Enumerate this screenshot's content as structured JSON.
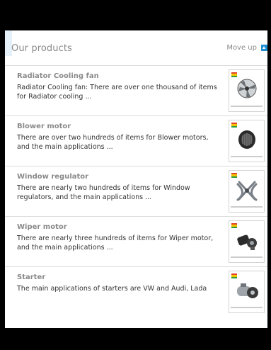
{
  "section": {
    "title": "Our products",
    "move_up_label": "Move up"
  },
  "products": [
    {
      "title": "Radiator Cooling fan",
      "description": "Radiator Cooling fan: There are over one thousand of items for Radiator cooling ...",
      "image": "radiator-cooling-fan-image"
    },
    {
      "title": "Blower motor",
      "description": "There are over two hundreds of items for Blower motors, and the main applications ...",
      "image": "blower-motor-image"
    },
    {
      "title": "Window regulator",
      "description": "There are nearly two hundreds of items for Window regulators, and the main applications ...",
      "image": "window-regulator-image"
    },
    {
      "title": "Wiper motor",
      "description": "There are nearly three hundreds of items for Wiper motor, and the main applications ...",
      "image": "wiper-motor-image"
    },
    {
      "title": "Starter",
      "description": "The main applications of starters are VW and Audi, Lada",
      "image": "starter-image"
    }
  ],
  "colors": {
    "frame": "#000000",
    "heading": "#8a8a8a",
    "text": "#333333",
    "accent": "#1f8fd6",
    "flag_top": "#e0452b",
    "flag_mid": "#f2c500",
    "flag_bottom": "#2d9b3a"
  }
}
